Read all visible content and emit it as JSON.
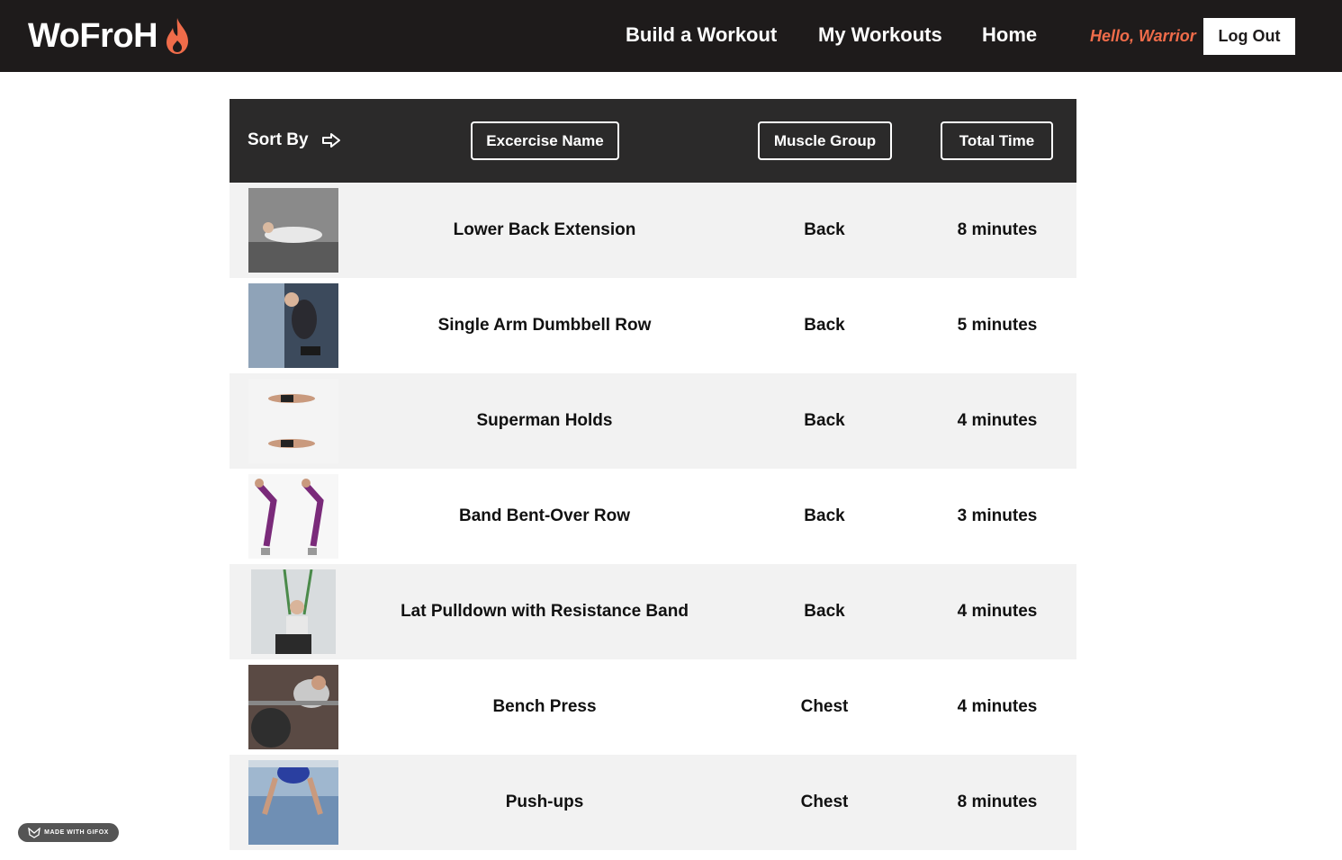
{
  "nav": {
    "brand": "WoFroH",
    "brand_accent": "#ef6c4a",
    "links": [
      "Build a Workout",
      "My Workouts",
      "Home"
    ],
    "greeting": "Hello, Warrior",
    "logout_label": "Log Out"
  },
  "table": {
    "sort_label": "Sort By",
    "sort_icon": "arrow-right-icon",
    "sort_buttons": [
      "Excercise Name",
      "Muscle Group",
      "Total Time"
    ],
    "rows": [
      {
        "name": "Lower Back Extension",
        "muscle": "Back",
        "time": "8 minutes"
      },
      {
        "name": "Single Arm Dumbbell Row",
        "muscle": "Back",
        "time": "5 minutes"
      },
      {
        "name": "Superman Holds",
        "muscle": "Back",
        "time": "4 minutes"
      },
      {
        "name": "Band Bent-Over Row",
        "muscle": "Back",
        "time": "3 minutes"
      },
      {
        "name": "Lat Pulldown with Resistance Band",
        "muscle": "Back",
        "time": "4 minutes"
      },
      {
        "name": "Bench Press",
        "muscle": "Chest",
        "time": "4 minutes"
      },
      {
        "name": "Push-ups",
        "muscle": "Chest",
        "time": "8 minutes"
      }
    ]
  },
  "watermark": "MADE WITH GIFOX"
}
